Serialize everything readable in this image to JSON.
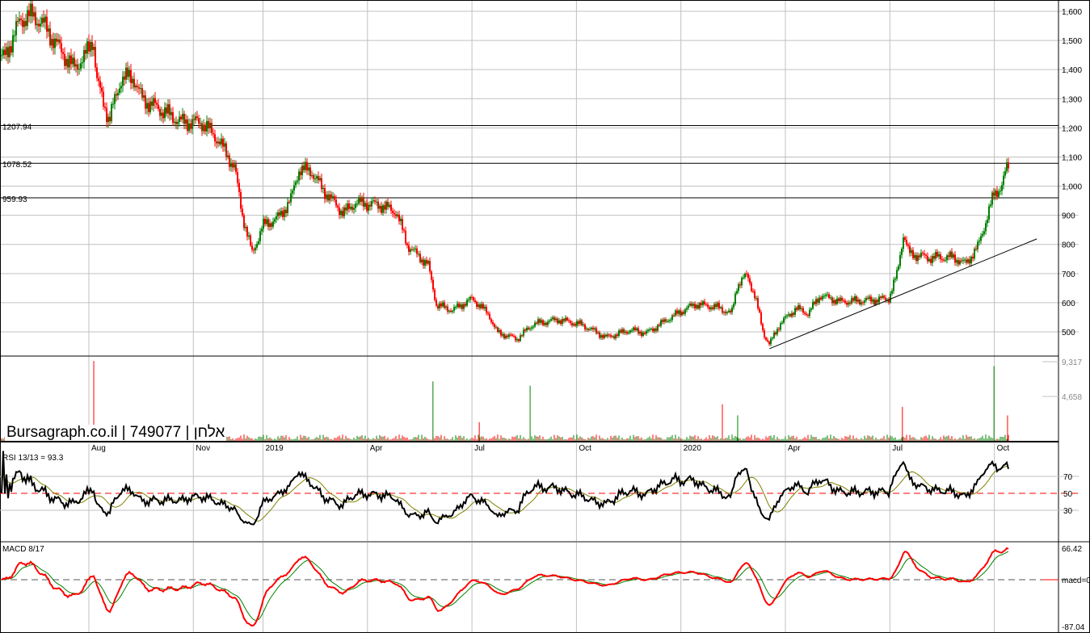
{
  "header": {
    "brand": "Bursagraph.co.il | 749077 | אלחן"
  },
  "chart_data": [
    {
      "type": "candlestick",
      "title": "Price",
      "x_unit": "months since Jan 2018",
      "yticks": [
        "1,600",
        "1,500",
        "1,400",
        "1,300",
        "1,200",
        "1,100",
        "1,000",
        "900",
        "800",
        "700",
        "600",
        "500"
      ],
      "ytick_values": [
        1600,
        1500,
        1400,
        1300,
        1200,
        1100,
        1000,
        900,
        800,
        700,
        600,
        500
      ],
      "ylim": [
        455,
        1640
      ],
      "close_path": [
        [
          4.56,
          1440
        ],
        [
          5.03,
          1580
        ],
        [
          5.26,
          1600
        ],
        [
          5.61,
          1580
        ],
        [
          6.07,
          1490
        ],
        [
          6.54,
          1400
        ],
        [
          6.88,
          1430
        ],
        [
          7.12,
          1500
        ],
        [
          7.23,
          1350
        ],
        [
          7.58,
          1220
        ],
        [
          7.93,
          1370
        ],
        [
          8.28,
          1380
        ],
        [
          8.51,
          1310
        ],
        [
          9.09,
          1270
        ],
        [
          9.67,
          1220
        ],
        [
          10.25,
          1210
        ],
        [
          10.71,
          1150
        ],
        [
          11.18,
          1060
        ],
        [
          11.41,
          900
        ],
        [
          11.69,
          770
        ],
        [
          11.99,
          870
        ],
        [
          12.45,
          900
        ],
        [
          12.8,
          960
        ],
        [
          13.03,
          1060
        ],
        [
          13.38,
          1050
        ],
        [
          13.73,
          980
        ],
        [
          14.31,
          900
        ],
        [
          14.66,
          940
        ],
        [
          15.35,
          940
        ],
        [
          15.82,
          920
        ],
        [
          16.16,
          800
        ],
        [
          16.74,
          730
        ],
        [
          16.98,
          590
        ],
        [
          17.44,
          570
        ],
        [
          18.02,
          610
        ],
        [
          18.48,
          560
        ],
        [
          18.72,
          500
        ],
        [
          19.3,
          480
        ],
        [
          19.76,
          530
        ],
        [
          20.46,
          540
        ],
        [
          21.15,
          520
        ],
        [
          21.85,
          480
        ],
        [
          22.55,
          510
        ],
        [
          23.01,
          500
        ],
        [
          23.71,
          550
        ],
        [
          24.4,
          590
        ],
        [
          25.1,
          580
        ],
        [
          25.45,
          560
        ],
        [
          25.61,
          660
        ],
        [
          25.91,
          700
        ],
        [
          26.14,
          620
        ],
        [
          26.37,
          500
        ],
        [
          26.54,
          460
        ],
        [
          26.84,
          530
        ],
        [
          27.3,
          580
        ],
        [
          27.65,
          560
        ],
        [
          28.0,
          620
        ],
        [
          28.58,
          600
        ],
        [
          29.27,
          610
        ],
        [
          29.97,
          620
        ],
        [
          30.2,
          700
        ],
        [
          30.39,
          840
        ],
        [
          30.55,
          770
        ],
        [
          31.13,
          750
        ],
        [
          31.83,
          750
        ],
        [
          32.17,
          730
        ],
        [
          32.52,
          790
        ],
        [
          32.8,
          900
        ],
        [
          32.99,
          980
        ],
        [
          33.22,
          1010
        ],
        [
          33.38,
          1080
        ]
      ],
      "levels": [
        {
          "value": 1207.94,
          "label": "1207.94"
        },
        {
          "value": 1078.52,
          "label": "1078.52"
        },
        {
          "value": 959.93,
          "label": "959.93"
        }
      ],
      "trendline": [
        [
          26.54,
          442
        ],
        [
          34.22,
          819
        ]
      ],
      "xticks": [
        {
          "m": 7,
          "label": "Aug"
        },
        {
          "m": 10,
          "label": "Nov"
        },
        {
          "m": 12,
          "label": "2019"
        },
        {
          "m": 15,
          "label": "Apr"
        },
        {
          "m": 18,
          "label": "Jul"
        },
        {
          "m": 21,
          "label": "Oct"
        },
        {
          "m": 24,
          "label": "2020"
        },
        {
          "m": 27,
          "label": "Apr"
        },
        {
          "m": 30,
          "label": "Jul"
        },
        {
          "m": 33,
          "label": "Oct"
        }
      ],
      "colors": {
        "up": "#008000",
        "down": "#ff0000"
      }
    },
    {
      "type": "bar",
      "title": "Volume",
      "yticks": [
        "9,317",
        "4,658"
      ],
      "ytick_values": [
        9317,
        4658
      ],
      "spikes": [
        [
          7.14,
          9400
        ],
        [
          16.88,
          7000
        ],
        [
          18.21,
          2200
        ],
        [
          19.67,
          6500
        ],
        [
          25.19,
          4300
        ],
        [
          25.63,
          3000
        ],
        [
          30.36,
          4000
        ],
        [
          32.99,
          8800
        ],
        [
          33.38,
          3000
        ]
      ]
    },
    {
      "type": "line",
      "title": "RSI 13/13 = 93.3",
      "yticks": [
        "70",
        "50",
        "30"
      ],
      "ytick_values": [
        70,
        50,
        30
      ],
      "ylim": [
        0,
        100
      ]
    },
    {
      "type": "line",
      "title": "MACD 8/17",
      "yticks": [
        "66.42",
        "macd=0",
        "-87.04"
      ],
      "ylim": [
        -87.04,
        66.42
      ]
    }
  ]
}
